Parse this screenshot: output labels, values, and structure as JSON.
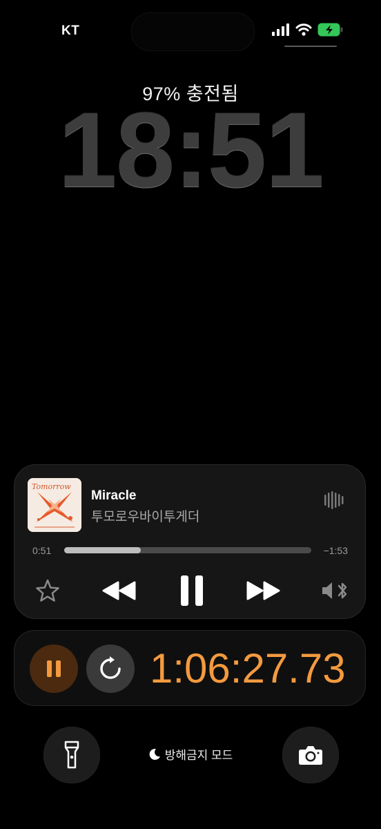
{
  "status_bar": {
    "carrier": "KT",
    "icons": [
      "cellular-signal-icon",
      "wifi-icon",
      "battery-charging-icon"
    ]
  },
  "lock_screen": {
    "charging_status": "97% 충전됨",
    "time": "18:51"
  },
  "now_playing": {
    "title": "Miracle",
    "artist": "투모로우바이투게더",
    "elapsed": "0:51",
    "remaining": "−1:53",
    "progress_fraction": 0.31,
    "album_art_text": "Tomorrow",
    "controls": [
      "favorite-star-icon",
      "rewind-icon",
      "pause-icon",
      "fast-forward-icon",
      "audio-output-icon"
    ]
  },
  "stopwatch": {
    "elapsed": "1:06:27.73",
    "accent_color": "#f39a3f",
    "pause_button_color": "#4b2a10"
  },
  "bottom_bar": {
    "focus_mode_label": "방해금지 모드",
    "left_button": "flashlight-icon",
    "right_button": "camera-icon"
  }
}
